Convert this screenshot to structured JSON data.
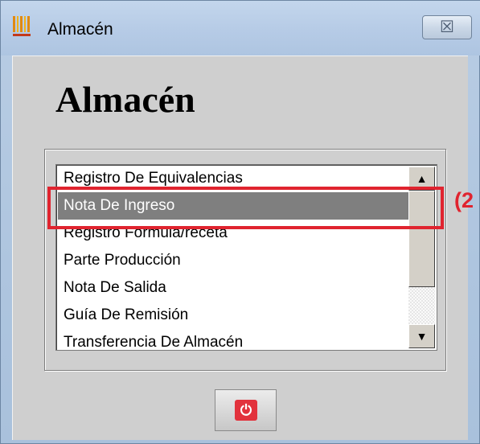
{
  "window": {
    "title": "Almacén",
    "close_glyph": "☒"
  },
  "heading": "Almacén",
  "list": {
    "items": [
      "Registro De Equivalencias",
      "Nota De Ingreso",
      "Registro Formula/receta",
      "Parte Producción",
      "Nota De Salida",
      "Guía De Remisión",
      "Transferencia De Almacén"
    ],
    "selected_index": 1
  },
  "scrollbar": {
    "up_glyph": "▲",
    "down_glyph": "▼"
  },
  "annotation": {
    "text": "(2",
    "color": "#e0242f"
  },
  "power_button": {
    "icon": "power-icon",
    "glyph": "⏻",
    "color": "#e2323c"
  },
  "colors": {
    "selection": "#7f7f7f",
    "highlight": "#e0242f"
  }
}
